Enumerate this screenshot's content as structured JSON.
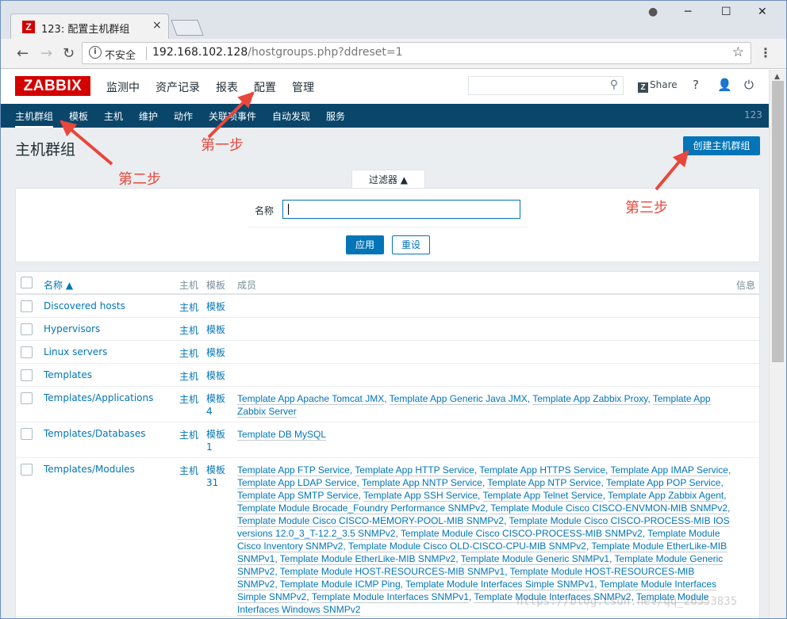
{
  "browser": {
    "tab_title": "123: 配置主机群组",
    "tab_close": "×",
    "favicon": "Z",
    "insecure_label": "不安全",
    "url_host": "192.168.102.128",
    "url_path": "/hostgroups.php?ddreset=1",
    "controls": {
      "minimize": "─",
      "maximize": "☐",
      "close": "✕",
      "profile": "●"
    }
  },
  "zabbix": {
    "logo": "ZABBIX",
    "main_menu": [
      "监测中",
      "资产记录",
      "报表",
      "配置",
      "管理"
    ],
    "share_label": "Share",
    "help_icon": "?",
    "sub_menu": [
      "主机群组",
      "模板",
      "主机",
      "维护",
      "动作",
      "关联项事件",
      "自动发现",
      "服务"
    ],
    "sub_right": "123",
    "page_title": "主机群组",
    "create_button": "创建主机群组",
    "filter": {
      "tab_label": "过滤器 ▲",
      "name_label": "名称",
      "name_value": "",
      "apply_label": "应用",
      "reset_label": "重设"
    },
    "table": {
      "headers": {
        "name": "名称 ▲",
        "hosts": "主机",
        "templates": "模板",
        "members": "成员",
        "info": "信息"
      },
      "rows": [
        {
          "name": "Discovered hosts",
          "hosts": "主机",
          "templates": "模板",
          "members": []
        },
        {
          "name": "Hypervisors",
          "hosts": "主机",
          "templates": "模板",
          "members": []
        },
        {
          "name": "Linux servers",
          "hosts": "主机",
          "templates": "模板",
          "members": []
        },
        {
          "name": "Templates",
          "hosts": "主机",
          "templates": "模板",
          "members": []
        },
        {
          "name": "Templates/Applications",
          "hosts": "主机",
          "templates": "模板 4",
          "members": [
            "Template App Apache Tomcat JMX",
            "Template App Generic Java JMX",
            "Template App Zabbix Proxy",
            "Template App Zabbix Server"
          ]
        },
        {
          "name": "Templates/Databases",
          "hosts": "主机",
          "templates": "模板 1",
          "members": [
            "Template DB MySQL"
          ]
        },
        {
          "name": "Templates/Modules",
          "hosts": "主机",
          "templates": "模板 31",
          "members": [
            "Template App FTP Service",
            "Template App HTTP Service",
            "Template App HTTPS Service",
            "Template App IMAP Service",
            "Template App LDAP Service",
            "Template App NNTP Service",
            "Template App NTP Service",
            "Template App POP Service",
            "Template App SMTP Service",
            "Template App SSH Service",
            "Template App Telnet Service",
            "Template App Zabbix Agent",
            "Template Module Brocade_Foundry Performance SNMPv2",
            "Template Module Cisco CISCO-ENVMON-MIB SNMPv2",
            "Template Module Cisco CISCO-MEMORY-POOL-MIB SNMPv2",
            "Template Module Cisco CISCO-PROCESS-MIB IOS versions 12.0_3_T-12.2_3.5 SNMPv2",
            "Template Module Cisco CISCO-PROCESS-MIB SNMPv2",
            "Template Module Cisco Inventory SNMPv2",
            "Template Module Cisco OLD-CISCO-CPU-MIB SNMPv2",
            "Template Module EtherLike-MIB SNMPv1",
            "Template Module EtherLike-MIB SNMPv2",
            "Template Module Generic SNMPv1",
            "Template Module Generic SNMPv2",
            "Template Module HOST-RESOURCES-MIB SNMPv1",
            "Template Module HOST-RESOURCES-MIB SNMPv2",
            "Template Module ICMP Ping",
            "Template Module Interfaces Simple SNMPv1",
            "Template Module Interfaces Simple SNMPv2",
            "Template Module Interfaces SNMPv1",
            "Template Module Interfaces SNMPv2",
            "Template Module Interfaces Windows SNMPv2"
          ]
        }
      ]
    }
  },
  "annotations": {
    "step1": "第一步",
    "step2": "第二步",
    "step3": "第三步",
    "color": "#e8473d"
  },
  "watermark": "https://blog.csdn.net/qq_26553835",
  "colors": {
    "zabbix_red": "#d40000",
    "nav_blue": "#0a466a",
    "link_blue": "#0275b8"
  }
}
